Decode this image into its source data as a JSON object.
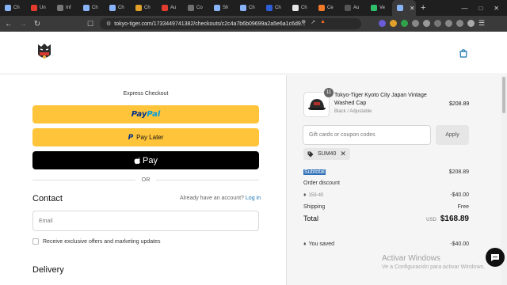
{
  "browser": {
    "tabs": [
      {
        "label": "Ch",
        "color": "#8ab4f8",
        "active": false
      },
      {
        "label": "Un",
        "color": "#e33b2e",
        "active": false
      },
      {
        "label": "Inf",
        "color": "#777777",
        "active": false
      },
      {
        "label": "Ch",
        "color": "#8ab4f8",
        "active": false
      },
      {
        "label": "Ch",
        "color": "#8ab4f8",
        "active": false
      },
      {
        "label": "Ch",
        "color": "#e0a02a",
        "active": false
      },
      {
        "label": "Au",
        "color": "#e33b2e",
        "active": false
      },
      {
        "label": "Co",
        "color": "#6f6f6f",
        "active": false
      },
      {
        "label": "Sh",
        "color": "#8ab4f8",
        "active": false
      },
      {
        "label": "Ch",
        "color": "#8ab4f8",
        "active": false
      },
      {
        "label": "Ch",
        "color": "#2d5fd6",
        "active": false
      },
      {
        "label": "Ch",
        "color": "#e6e6e6",
        "active": false
      },
      {
        "label": "Ce",
        "color": "#f07a2a",
        "active": false
      },
      {
        "label": "Au",
        "color": "#555555",
        "active": false
      },
      {
        "label": "Ve",
        "color": "#2fc16a",
        "active": false
      },
      {
        "label": "",
        "color": "#8ab4f8",
        "active": true
      }
    ],
    "url": "tokyo-tiger.com/1733449741382/checkouts/c2c4a7b6b09699a2a5e6a1c6d9..."
  },
  "checkout": {
    "express_title": "Express Checkout",
    "paypal_part1": "Pay",
    "paypal_part2": "Pal",
    "paylater_mark": "P",
    "paylater_label": "Pay Later",
    "applepay_label": "Pay",
    "or_label": "OR",
    "contact_title": "Contact",
    "account_prompt": "Already have an account?",
    "login_label": "Log in",
    "email_placeholder": "Email",
    "offers_label": "Receive exclusive offers and marketing updates",
    "delivery_title": "Delivery"
  },
  "summary": {
    "quantity": "11",
    "product_name": "Tokyo-Tiger Kyoto City Japan Vintage Washed Cap",
    "product_variant": "Black / Adjustable",
    "product_price": "$208.89",
    "code_placeholder": "Gift cards or coupon codes",
    "apply_label": "Apply",
    "discount_code": "SUM40",
    "subtotal_label": "Subtotal",
    "subtotal_value": "$208.89",
    "order_discount_label": "Order discount",
    "discount_detail": "159-40",
    "discount_value": "-$40.00",
    "shipping_label": "Shipping",
    "shipping_value": "Free",
    "total_label": "Total",
    "total_currency": "USD",
    "total_value": "$168.89",
    "saved_label": "You saved",
    "saved_value": "-$40.00"
  },
  "watermark": {
    "line1": "Activar Windows",
    "line2": "Ve a Configuración para activar Windows."
  },
  "colors": {
    "paypal_yellow": "#ffc439",
    "link_blue": "#1773b0",
    "selection_blue": "#2f6fb8"
  }
}
